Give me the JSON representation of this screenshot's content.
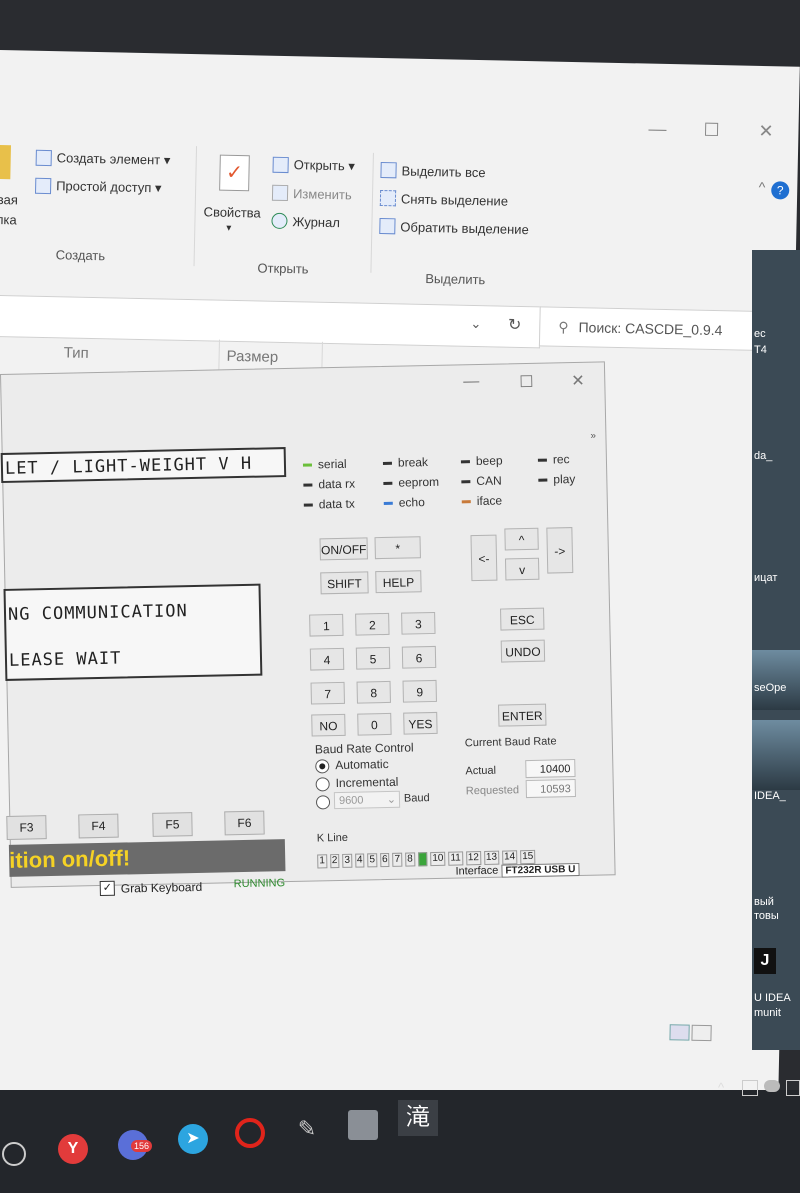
{
  "ribbon": {
    "new_group": {
      "new_item": "Создать элемент ▾",
      "easy_access": "Простой доступ ▾",
      "folder_partial": "вая\nпка",
      "label": "Создать"
    },
    "open_group": {
      "properties": "Свойства",
      "properties_arrow": "▾",
      "open": "Открыть ▾",
      "edit": "Изменить",
      "history": "Журнал",
      "label": "Открыть"
    },
    "select_group": {
      "select_all": "Выделить все",
      "select_none": "Снять выделение",
      "invert": "Обратить выделение",
      "label": "Выделить"
    }
  },
  "address": {
    "search_placeholder": "Поиск: CASCDE_0.9.4"
  },
  "columns": {
    "type": "Тип",
    "size": "Размер"
  },
  "dialog": {
    "lcd_title": "LET / LIGHT-WEIGHT V H",
    "lcd_line1": "NG COMMUNICATION",
    "lcd_line2": "LEASE WAIT",
    "fkeys": [
      "F3",
      "F4",
      "F5",
      "F6"
    ],
    "banner": "ition on/off!",
    "grab_keyboard": "Grab Keyboard",
    "status": "RUNNING",
    "leds_col1": [
      "serial",
      "data rx",
      "data tx"
    ],
    "leds_col2": [
      "break",
      "eeprom",
      "echo"
    ],
    "leds_col3": [
      "beep",
      "CAN",
      "iface"
    ],
    "leds_col4": [
      "rec",
      "play"
    ],
    "buttons": {
      "onoff": "ON/OFF",
      "star": "*",
      "shift": "SHIFT",
      "help": "HELP",
      "n1": "1",
      "n2": "2",
      "n3": "3",
      "n4": "4",
      "n5": "5",
      "n6": "6",
      "n7": "7",
      "n8": "8",
      "n9": "9",
      "no": "NO",
      "n0": "0",
      "yes": "YES",
      "esc": "ESC",
      "undo": "UNDO",
      "enter": "ENTER",
      "left": "<-",
      "right": "->",
      "up": "^",
      "down": "v"
    },
    "baud_control": {
      "title": "Baud Rate Control",
      "automatic": "Automatic",
      "incremental": "Incremental",
      "select_value": "9600",
      "baud_label": "Baud"
    },
    "current_baud": {
      "title": "Current Baud Rate",
      "actual_label": "Actual",
      "actual_value": "10400",
      "requested_label": "Requested",
      "requested_value": "10593"
    },
    "kline_title": "K Line",
    "kline": [
      "1",
      "2",
      "3",
      "4",
      "5",
      "6",
      "7",
      "8",
      "9",
      "10",
      "11",
      "12",
      "13",
      "14",
      "15"
    ],
    "kline_active": "9",
    "interface_label": "Interface",
    "interface_value": "FT232R USB U"
  },
  "desktop_strip": [
    "ec",
    "T4",
    "da_",
    "ицат",
    "seOpe",
    "IDEA_",
    "вый",
    "товы",
    "J",
    "U IDEA",
    "munit"
  ],
  "taskbar": {
    "badge": "156",
    "ime": "滝"
  }
}
